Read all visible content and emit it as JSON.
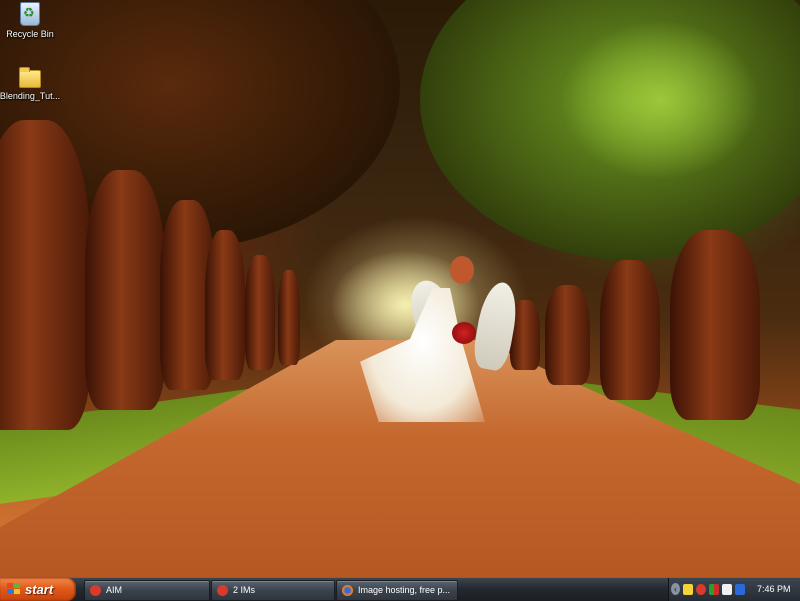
{
  "desktop": {
    "icons": [
      {
        "label": "Recycle Bin",
        "icon": "recycle-bin-icon"
      },
      {
        "label": "Blending_Tut...",
        "icon": "folder-icon"
      }
    ]
  },
  "taskbar": {
    "start_label": "start",
    "tasks": [
      {
        "label": "AIM",
        "icon": "aim-icon",
        "color": "#d93a2b"
      },
      {
        "label": "2 IMs",
        "icon": "aim-icon",
        "color": "#d93a2b"
      },
      {
        "label": "Image hosting, free p...",
        "icon": "firefox-icon",
        "color": "#e8822a"
      }
    ],
    "tray": {
      "icons": [
        "chevron-left-icon",
        "yahoo-icon",
        "aim-tray-icon",
        "network-icon",
        "mail-icon",
        "bluetooth-icon"
      ],
      "clock": "7:46 PM"
    }
  },
  "colors": {
    "start_button": "#e05a1a",
    "taskbar": "#25292f"
  }
}
